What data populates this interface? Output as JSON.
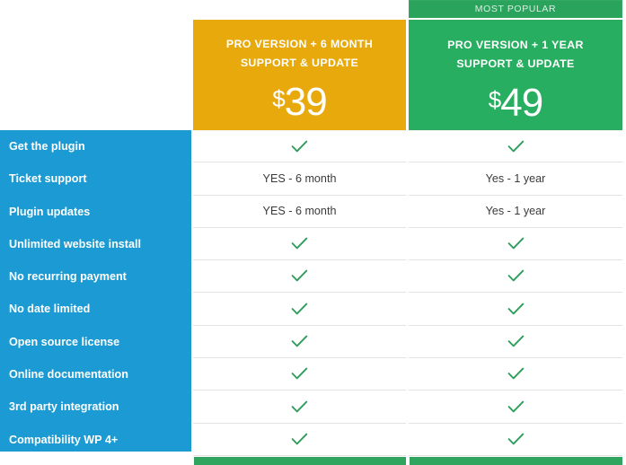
{
  "plans": [
    {
      "id": "standard",
      "badge": "",
      "title_line1": "PRO VERSION + 6 MONTH",
      "title_line2": "SUPPORT & UPDATE",
      "currency": "$",
      "amount": "39",
      "accent_color": "#e8a90c"
    },
    {
      "id": "popular",
      "badge": "MOST POPULAR",
      "title_line1": "PRO VERSION + 1 YEAR",
      "title_line2": "SUPPORT & UPDATE",
      "currency": "$",
      "amount": "49",
      "accent_color": "#27ae60"
    }
  ],
  "sidebar": {
    "background_color": "#1b9ad3",
    "items": [
      {
        "label": "Get the plugin"
      },
      {
        "label": "Ticket support"
      },
      {
        "label": "Plugin updates"
      },
      {
        "label": "Unlimited website install"
      },
      {
        "label": "No recurring payment"
      },
      {
        "label": "No date limited"
      },
      {
        "label": "Open source license"
      },
      {
        "label": "Online documentation"
      },
      {
        "label": "3rd party integration"
      },
      {
        "label": "Compatibility WP 4+"
      }
    ]
  },
  "rows": [
    {
      "feature": "Get the plugin",
      "standard": {
        "type": "check"
      },
      "popular": {
        "type": "check"
      }
    },
    {
      "feature": "Ticket support",
      "standard": {
        "type": "text",
        "text": "YES - 6 month"
      },
      "popular": {
        "type": "text",
        "text": "Yes - 1 year"
      }
    },
    {
      "feature": "Plugin updates",
      "standard": {
        "type": "text",
        "text": "YES - 6 month"
      },
      "popular": {
        "type": "text",
        "text": "Yes - 1 year"
      }
    },
    {
      "feature": "Unlimited website install",
      "standard": {
        "type": "check"
      },
      "popular": {
        "type": "check"
      }
    },
    {
      "feature": "No recurring payment",
      "standard": {
        "type": "check"
      },
      "popular": {
        "type": "check"
      }
    },
    {
      "feature": "No date limited",
      "standard": {
        "type": "check"
      },
      "popular": {
        "type": "check"
      }
    },
    {
      "feature": "Open source license",
      "standard": {
        "type": "check"
      },
      "popular": {
        "type": "check"
      }
    },
    {
      "feature": "Online documentation",
      "standard": {
        "type": "check"
      },
      "popular": {
        "type": "check"
      }
    },
    {
      "feature": "3rd party integration",
      "standard": {
        "type": "check"
      },
      "popular": {
        "type": "check"
      }
    },
    {
      "feature": "Compatibility WP 4+",
      "standard": {
        "type": "check"
      },
      "popular": {
        "type": "check"
      }
    }
  ],
  "icons": {
    "check": "check-icon"
  },
  "colors": {
    "sidebar_blue": "#1b9ad3",
    "standard_orange": "#e8a90c",
    "popular_green": "#27ae60",
    "banner_green": "#2aa45c",
    "check_green": "#2e9e5b",
    "row_divider": "#e3e3e3",
    "cell_text": "#3b3b3b"
  }
}
